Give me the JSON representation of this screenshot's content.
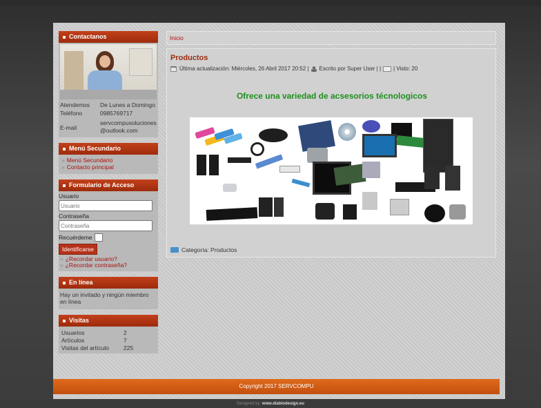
{
  "sidebar": {
    "contact": {
      "title": "Contactanos",
      "rows": [
        {
          "key": "Atendemos",
          "value": "De Lunes a Domingo"
        },
        {
          "key": "Teléfono",
          "value": "0985769717"
        },
        {
          "key": "E-mail",
          "value": "servcompusoluciones@outlook.com"
        }
      ]
    },
    "secondary_menu": {
      "title": "Menú Secundario",
      "items": [
        "Menú Secundario",
        "Contacto principal"
      ]
    },
    "login": {
      "title": "Formulario de Acceso",
      "user_label": "Usuario",
      "user_placeholder": "Usuario",
      "pass_label": "Contraseña",
      "pass_placeholder": "Contraseña",
      "remember_label": "Recuérdeme",
      "submit_label": "Identificarse",
      "links": [
        "¿Recordar usuario?",
        "¿Recordar contraseña?"
      ]
    },
    "online": {
      "title": "En línea",
      "text": "Hay un invitado y ningún miembro en línea"
    },
    "visits": {
      "title": "Visitas",
      "rows": [
        {
          "key": "Usuarios",
          "value": "2"
        },
        {
          "key": "Artículos",
          "value": "7"
        },
        {
          "key": "Visitas del artículo",
          "value": "225"
        }
      ]
    }
  },
  "breadcrumb": "Inicio",
  "article": {
    "title": "Productos",
    "meta": {
      "updated": "Última actualización: Miércoles, 26 Abril 2017 20:52 |",
      "author": "Escrito por Super User | |",
      "views": "| Visto: 20"
    },
    "headline": "Ofrece una variedad de acsesorios técnologicos",
    "category": "Categoría: Productos",
    "headline_color": "#1d8f1d"
  },
  "footer": {
    "copyright": "Copyright 2017  SERVCOMPU",
    "designed_by": "Designed by:",
    "designer": "www.diablodesign.eu"
  },
  "colors": {
    "accent": "#b5321a",
    "footer": "#d85d14"
  }
}
